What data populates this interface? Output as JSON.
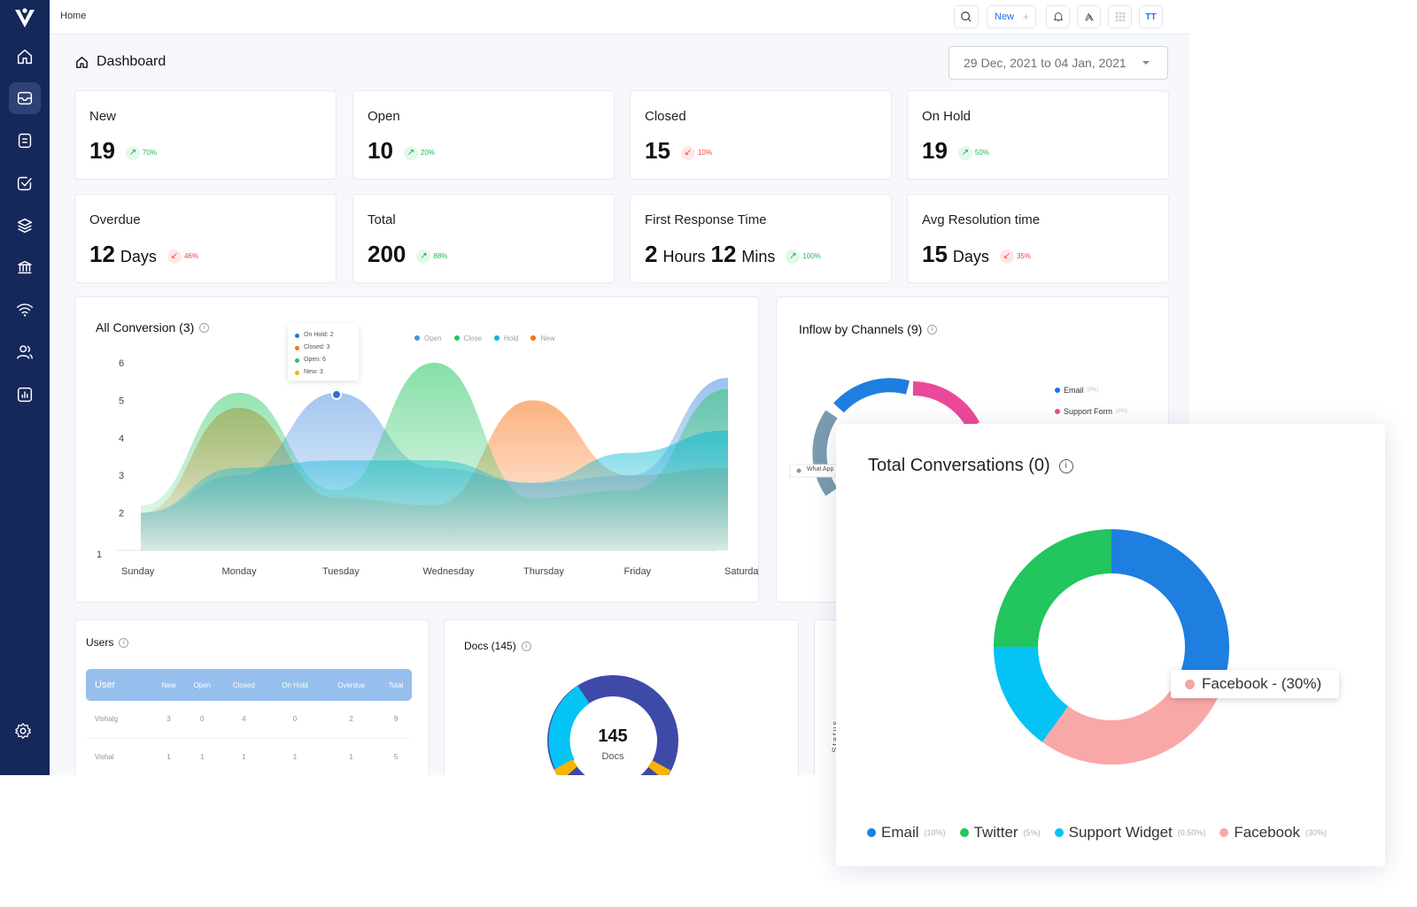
{
  "topbar": {
    "breadcrumb": "Home",
    "new_label": "New",
    "avatar": "TT"
  },
  "page": {
    "title": "Dashboard",
    "date_range": "29 Dec, 2021 to 04 Jan, 2021"
  },
  "stats": [
    {
      "label": "New",
      "value": "19",
      "unit": "",
      "value2": "",
      "unit2": "",
      "trend": "up",
      "pct": "70%"
    },
    {
      "label": "Open",
      "value": "10",
      "unit": "",
      "value2": "",
      "unit2": "",
      "trend": "up",
      "pct": "20%"
    },
    {
      "label": "Closed",
      "value": "15",
      "unit": "",
      "value2": "",
      "unit2": "",
      "trend": "down",
      "pct": "10%"
    },
    {
      "label": "On Hold",
      "value": "19",
      "unit": "",
      "value2": "",
      "unit2": "",
      "trend": "up",
      "pct": "50%"
    },
    {
      "label": "Overdue",
      "value": "12",
      "unit": "Days",
      "value2": "",
      "unit2": "",
      "trend": "down",
      "pct": "46%"
    },
    {
      "label": "Total",
      "value": "200",
      "unit": "",
      "value2": "",
      "unit2": "",
      "trend": "up",
      "pct": "88%"
    },
    {
      "label": "First Response Time",
      "value": "2",
      "unit": "Hours",
      "value2": "12",
      "unit2": "Mins",
      "trend": "up",
      "pct": "100%"
    },
    {
      "label": "Avg Resolution time",
      "value": "15",
      "unit": "Days",
      "value2": "",
      "unit2": "",
      "trend": "down",
      "pct": "35%"
    }
  ],
  "conversion": {
    "title": "All Conversion (3)",
    "tooltip": [
      "On Hold: 2",
      "Closed: 3",
      "Open: 6",
      "New: 3"
    ]
  },
  "chart_data": {
    "type": "area",
    "x": [
      "Sunday",
      "Monday",
      "Tuesday",
      "Wednesday",
      "Thursday",
      "Friday",
      "Saturday"
    ],
    "ylim": [
      1,
      6
    ],
    "yticks": [
      "1",
      "2",
      "3",
      "4",
      "5",
      "6"
    ],
    "grid": false,
    "legend_position": "top",
    "series": [
      {
        "name": "Open",
        "color": "#4a90e2",
        "values": [
          2.0,
          3.0,
          5.2,
          3.2,
          2.8,
          3.0,
          5.6
        ]
      },
      {
        "name": "Close",
        "color": "#22c55e",
        "values": [
          2.2,
          5.2,
          2.6,
          6.0,
          2.4,
          2.6,
          5.3
        ]
      },
      {
        "name": "Hold",
        "color": "#06b6d4",
        "values": [
          2.0,
          3.2,
          3.4,
          3.4,
          2.8,
          3.6,
          4.2
        ]
      },
      {
        "name": "New",
        "color": "#f97316",
        "values": [
          2.0,
          4.8,
          2.4,
          2.2,
          5.0,
          3.0,
          3.2
        ]
      }
    ]
  },
  "inflow": {
    "title": "Inflow by Channels (9)",
    "legend": [
      {
        "label": "Email",
        "pct": "(0%)",
        "color": "#1a73e8"
      },
      {
        "label": "Support Form",
        "pct": "(0%)",
        "color": "#ec4899"
      }
    ],
    "side_label": "What App"
  },
  "users": {
    "title": "Users",
    "columns": [
      "User",
      "New",
      "Open",
      "Closed",
      "On Hold",
      "Overdue",
      "Total"
    ],
    "rows": [
      [
        "Vishalg",
        "3",
        "0",
        "4",
        "0",
        "2",
        "9"
      ],
      [
        "Vishal",
        "1",
        "1",
        "1",
        "1",
        "1",
        "5"
      ]
    ]
  },
  "docs": {
    "title": "Docs (145)",
    "count": "145",
    "label": "Docs"
  },
  "status_axis_label": "Status",
  "total_conversations": {
    "title": "Total Conversations (0)",
    "tooltip": "Facebook - (30%)",
    "segments": [
      {
        "label": "Email",
        "pct": "(10%)",
        "color": "#1e7fe0",
        "share": 0.3
      },
      {
        "label": "Facebook",
        "pct": "(30%)",
        "color": "#f9a8a8",
        "share": 0.3
      },
      {
        "label": "Support Widget",
        "pct": "(0.50%)",
        "color": "#06c3f5",
        "share": 0.15
      },
      {
        "label": "Twitter",
        "pct": "(5%)",
        "color": "#22c55e",
        "share": 0.25
      }
    ],
    "legend_order": [
      "Email",
      "Twitter",
      "Support Widget",
      "Facebook"
    ]
  }
}
